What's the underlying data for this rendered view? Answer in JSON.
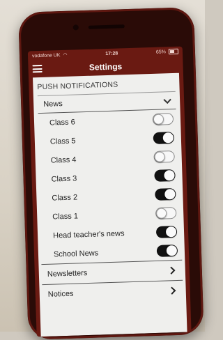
{
  "status_bar": {
    "carrier": "vodafone UK",
    "time": "17:28",
    "battery": "65%"
  },
  "nav": {
    "title": "Settings"
  },
  "section": {
    "header": "PUSH NOTIFICATIONS"
  },
  "news_group": {
    "label": "News"
  },
  "subscriptions": [
    {
      "label": "Class 6",
      "on": false
    },
    {
      "label": "Class 5",
      "on": true
    },
    {
      "label": "Class 4",
      "on": false
    },
    {
      "label": "Class 3",
      "on": true
    },
    {
      "label": "Class 2",
      "on": true
    },
    {
      "label": "Class 1",
      "on": false
    },
    {
      "label": "Head teacher's news",
      "on": true
    },
    {
      "label": "School News",
      "on": true
    }
  ],
  "bottom_rows": [
    {
      "label": "Newsletters"
    },
    {
      "label": "Notices"
    }
  ],
  "colors": {
    "app_bar": "#6a1a12",
    "phone_body": "#2a0b07",
    "toggle_on": "#111111"
  }
}
